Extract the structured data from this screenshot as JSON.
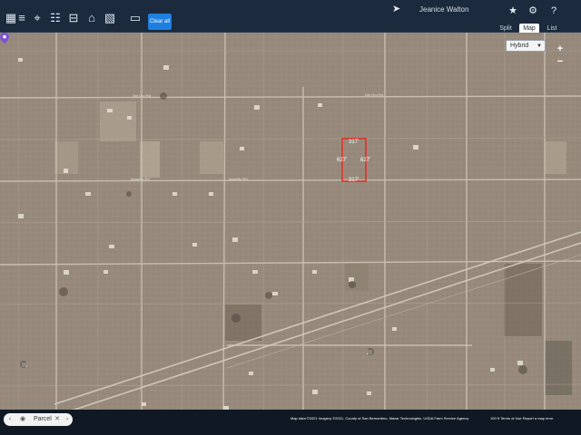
{
  "toolbar": {
    "tools": [
      {
        "icon": "layers-icon",
        "glyph": "▦"
      },
      {
        "icon": "stack-icon",
        "glyph": "≡"
      },
      {
        "icon": "location-pin-icon",
        "glyph": "⌖"
      },
      {
        "icon": "chart-icon",
        "glyph": "☷"
      },
      {
        "icon": "car-icon",
        "glyph": "⊟"
      },
      {
        "icon": "building-icon",
        "glyph": "⌂"
      },
      {
        "icon": "shapes-icon",
        "glyph": "▧"
      },
      {
        "icon": "comment-icon",
        "glyph": "▭"
      }
    ],
    "clear_all": "Clear all"
  },
  "header": {
    "user_name": "Jeanice Walton",
    "star_icon": "★",
    "gear_icon": "⚙",
    "help_icon": "?"
  },
  "view_tabs": [
    "Split",
    "Map",
    "List"
  ],
  "active_tab": "Map",
  "map": {
    "map_type": "Hybrid",
    "zoom_in": "+",
    "zoom_out": "−",
    "dimension_labels": {
      "top": "317'",
      "left": "627'",
      "right": "627'",
      "bottom": "317'"
    },
    "road_labels": [
      "Del Oro Rd",
      "Del Oro Rd",
      "Amarillo Rd",
      "Amarillo Rd"
    ]
  },
  "bottom": {
    "parcel_label": "Parcel",
    "attribution": "Map data ©2021 Imagery ©2021, County of San Bernardino, Maxar Technologies, USDA Farm Service Agency",
    "scale": "100 ft",
    "links": "Terms of Use   Report a map error"
  },
  "colors": {
    "toolbar_bg": "#1b2a3c",
    "accent": "#1e7fe0",
    "parcel_outline": "#e0302a",
    "terrain": "#978a7c"
  }
}
